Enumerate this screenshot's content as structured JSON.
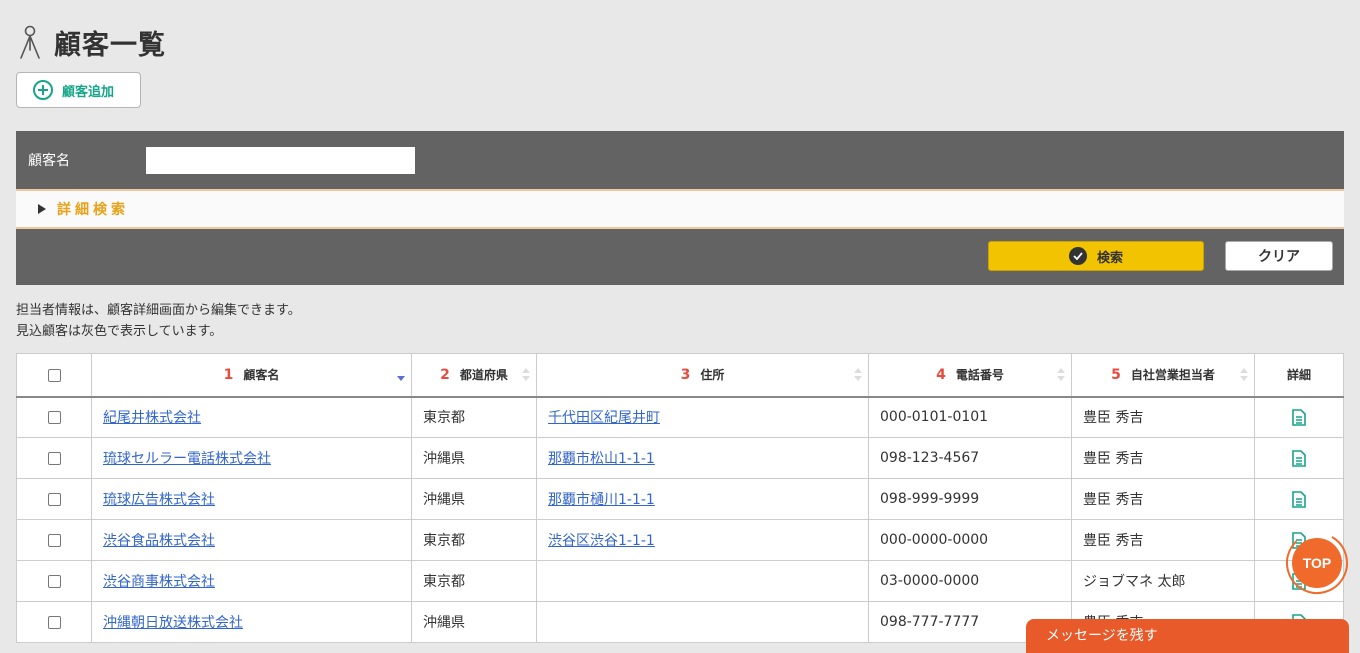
{
  "header": {
    "title": "顧客一覧",
    "icon": "person-icon"
  },
  "toolbar": {
    "add_label": "顧客追加"
  },
  "search": {
    "name_label": "顧客名",
    "name_value": "",
    "advanced_label": "詳細検索",
    "search_label": "検索",
    "clear_label": "クリア"
  },
  "notes": [
    "担当者情報は、顧客詳細画面から編集できます。",
    "見込顧客は灰色で表示しています。"
  ],
  "table": {
    "columns": [
      {
        "num": "1",
        "label": "顧客名"
      },
      {
        "num": "2",
        "label": "都道府県"
      },
      {
        "num": "3",
        "label": "住所"
      },
      {
        "num": "4",
        "label": "電話番号"
      },
      {
        "num": "5",
        "label": "自社営業担当者"
      },
      {
        "num": "",
        "label": "詳細"
      }
    ],
    "rows": [
      {
        "name": "紀尾井株式会社",
        "pref": "東京都",
        "address": "千代田区紀尾井町",
        "phone": "000-0101-0101",
        "rep": "豊臣 秀吉"
      },
      {
        "name": "琉球セルラー電話株式会社",
        "pref": "沖縄県",
        "address": "那覇市松山1-1-1",
        "phone": "098-123-4567",
        "rep": "豊臣 秀吉"
      },
      {
        "name": "琉球広告株式会社",
        "pref": "沖縄県",
        "address": "那覇市樋川1-1-1",
        "phone": "098-999-9999",
        "rep": "豊臣 秀吉"
      },
      {
        "name": "渋谷食品株式会社",
        "pref": "東京都",
        "address": "渋谷区渋谷1-1-1",
        "phone": "000-0000-0000",
        "rep": "豊臣 秀吉"
      },
      {
        "name": "渋谷商事株式会社",
        "pref": "東京都",
        "address": "",
        "phone": "03-0000-0000",
        "rep": "ジョブマネ 太郎"
      },
      {
        "name": "沖縄朝日放送株式会社",
        "pref": "沖縄県",
        "address": "",
        "phone": "098-777-7777",
        "rep": "豊臣 秀吉"
      }
    ]
  },
  "floating": {
    "top_label": "TOP",
    "message_label": "メッセージを残す"
  },
  "colors": {
    "accent": "#17a589",
    "search_button": "#f2c300",
    "panel": "#636363",
    "top_button": "#f06a2c",
    "message_bar": "#e85a2a",
    "sort_number": "#e74c3c"
  }
}
